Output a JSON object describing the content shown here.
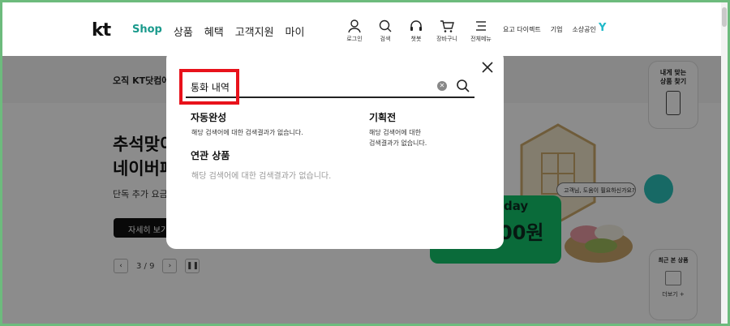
{
  "header": {
    "logo": "kt",
    "nav": [
      "Shop",
      "상품",
      "혜택",
      "고객지원",
      "마이"
    ],
    "util": [
      "로그인",
      "검색",
      "챗봇",
      "장바구니",
      "전체메뉴"
    ],
    "right_links": [
      "요고 다이렉트",
      "기업",
      "소상공인"
    ],
    "y_logo": "Y"
  },
  "page": {
    "notice": "오직 KT닷컴에",
    "hero_title_1": "추석맞이",
    "hero_title_2": "네이버페이",
    "hero_sub": "단독 추가 요금",
    "detail_button": "자세히 보기",
    "pager": "3 / 9",
    "promo_day": "day",
    "promo_amount": "00원",
    "side_card": "내게 맞는\n상품 찾기",
    "chat_bubble": "고객님, 도움이 필요하신가요?",
    "recent_title": "최근 본 상품",
    "recent_more": "더보기 +"
  },
  "search_modal": {
    "query": "통화 내역",
    "autocomplete_title": "자동완성",
    "autocomplete_text": "해당 검색어에 대한 검색결과가 없습니다.",
    "related_title": "연관 상품",
    "related_text": "해당 검색어에 대한 검색결과가 없습니다.",
    "event_title": "기획전",
    "event_text_1": "해당 검색어에 대한",
    "event_text_2": "검색결과가 없습니다."
  },
  "colors": {
    "accent": "#1a9a8c",
    "highlight": "#e8121b",
    "frame": "#6dbb7d"
  }
}
